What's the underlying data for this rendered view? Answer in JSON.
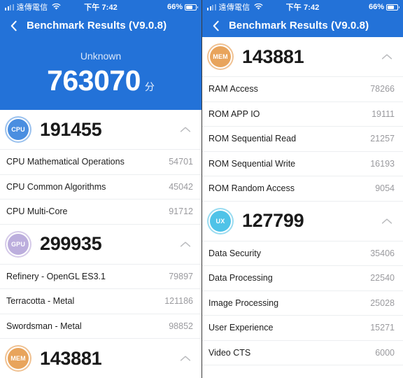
{
  "colors": {
    "brand_blue": "#2372d8",
    "cpu_badge": "#4a8ee0",
    "gpu_badge": "#bcaedd",
    "mem_badge": "#e8a45c",
    "ux_badge": "#4fc3e8",
    "value_gray": "#9a9a9e"
  },
  "status_bar": {
    "carrier": "遠傳電信",
    "signal_icon": "signal-bars-icon",
    "wifi_icon": "wifi-icon",
    "time": "下午 7:42",
    "battery_percent": "66%",
    "battery_icon": "battery-icon",
    "battery_level": 66
  },
  "nav": {
    "back_icon": "back-chevron-icon",
    "title": "Benchmark Results (V9.0.8)"
  },
  "hero": {
    "device_name": "Unknown",
    "total_score": "763070",
    "unit": "分"
  },
  "collapse_icon": "chevron-up-icon",
  "left_screen": {
    "groups": [
      {
        "badge": "CPU",
        "badge_class": "ring-cpu",
        "score": "191455",
        "rows": [
          {
            "label": "CPU Mathematical Operations",
            "value": "54701"
          },
          {
            "label": "CPU Common Algorithms",
            "value": "45042"
          },
          {
            "label": "CPU Multi-Core",
            "value": "91712"
          }
        ]
      },
      {
        "badge": "GPU",
        "badge_class": "ring-gpu",
        "score": "299935",
        "rows": [
          {
            "label": "Refinery - OpenGL ES3.1",
            "value": "79897"
          },
          {
            "label": "Terracotta - Metal",
            "value": "121186"
          },
          {
            "label": "Swordsman - Metal",
            "value": "98852"
          }
        ]
      },
      {
        "badge": "MEM",
        "badge_class": "ring-mem",
        "score": "143881",
        "rows": []
      }
    ]
  },
  "right_screen": {
    "groups": [
      {
        "badge": "MEM",
        "badge_class": "ring-mem",
        "score": "143881",
        "rows": [
          {
            "label": "RAM Access",
            "value": "78266"
          },
          {
            "label": "ROM APP IO",
            "value": "19111"
          },
          {
            "label": "ROM Sequential Read",
            "value": "21257"
          },
          {
            "label": "ROM Sequential Write",
            "value": "16193"
          },
          {
            "label": "ROM Random Access",
            "value": "9054"
          }
        ]
      },
      {
        "badge": "UX",
        "badge_class": "ring-ux",
        "score": "127799",
        "rows": [
          {
            "label": "Data Security",
            "value": "35406"
          },
          {
            "label": "Data Processing",
            "value": "22540"
          },
          {
            "label": "Image Processing",
            "value": "25028"
          },
          {
            "label": "User Experience",
            "value": "15271"
          },
          {
            "label": "Video CTS",
            "value": "6000"
          }
        ]
      }
    ]
  }
}
